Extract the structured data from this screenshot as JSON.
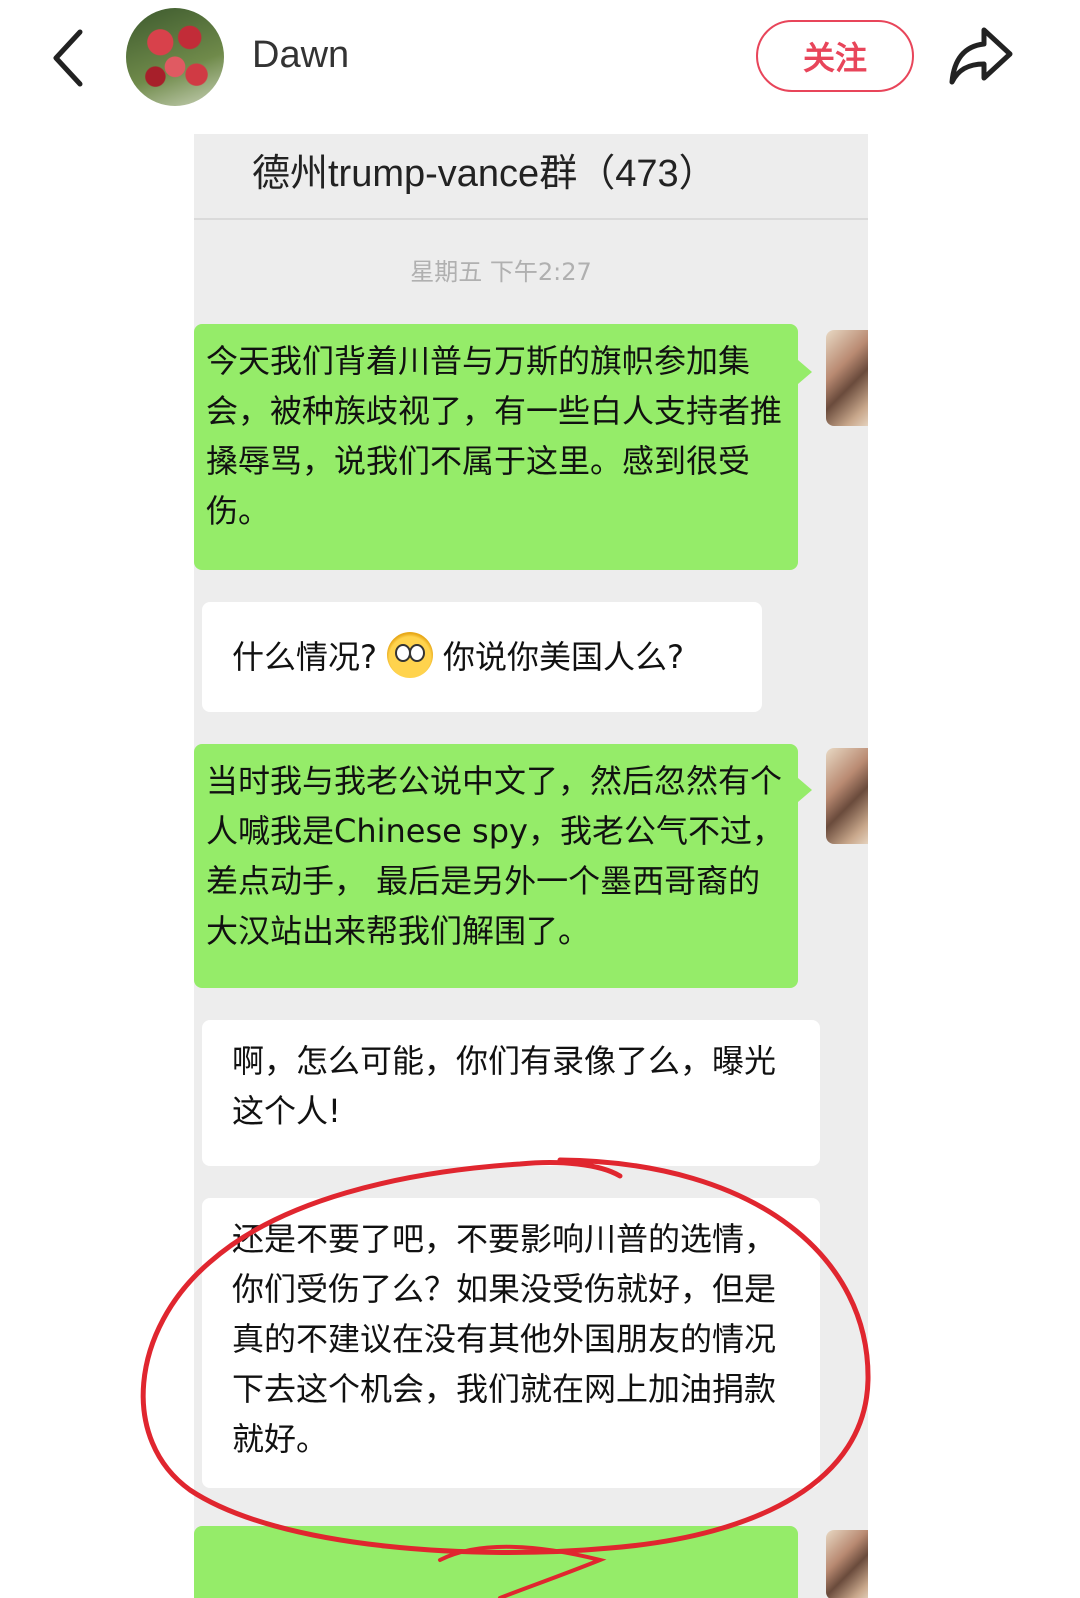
{
  "header": {
    "username": "Dawn",
    "follow_label": "关注"
  },
  "chat": {
    "title": "德州trump-vance群（473）",
    "timestamp": "星期五 下午2:27",
    "messages": [
      {
        "side": "self",
        "text": "今天我们背着川普与万斯的旗帜参加集会，被种族歧视了，有一些白人支持者推搡辱骂，说我们不属于这里。感到很受伤。"
      },
      {
        "side": "other",
        "text_before": "什么情况?",
        "emoji": "dizzy-face-emoji",
        "text_after": "你说你美国人么?"
      },
      {
        "side": "self",
        "text": "当时我与我老公说中文了，然后忽然有个人喊我是Chinese spy，我老公气不过，差点动手， 最后是另外一个墨西哥裔的大汉站出来帮我们解围了。"
      },
      {
        "side": "other",
        "text": "啊，怎么可能，你们有录像了么，曝光这个人!"
      },
      {
        "side": "other",
        "text": "还是不要了吧，不要影响川普的选情，你们受伤了么？如果没受伤就好，但是真的不建议在没有其他外国朋友的情况下去这个机会，我们就在网上加油捐款就好。"
      }
    ]
  },
  "colors": {
    "follow_accent": "#e8455a",
    "self_bubble": "#95ec69",
    "other_bubble": "#ffffff",
    "chat_background": "#ededed",
    "annotation_red": "#e0262f"
  }
}
